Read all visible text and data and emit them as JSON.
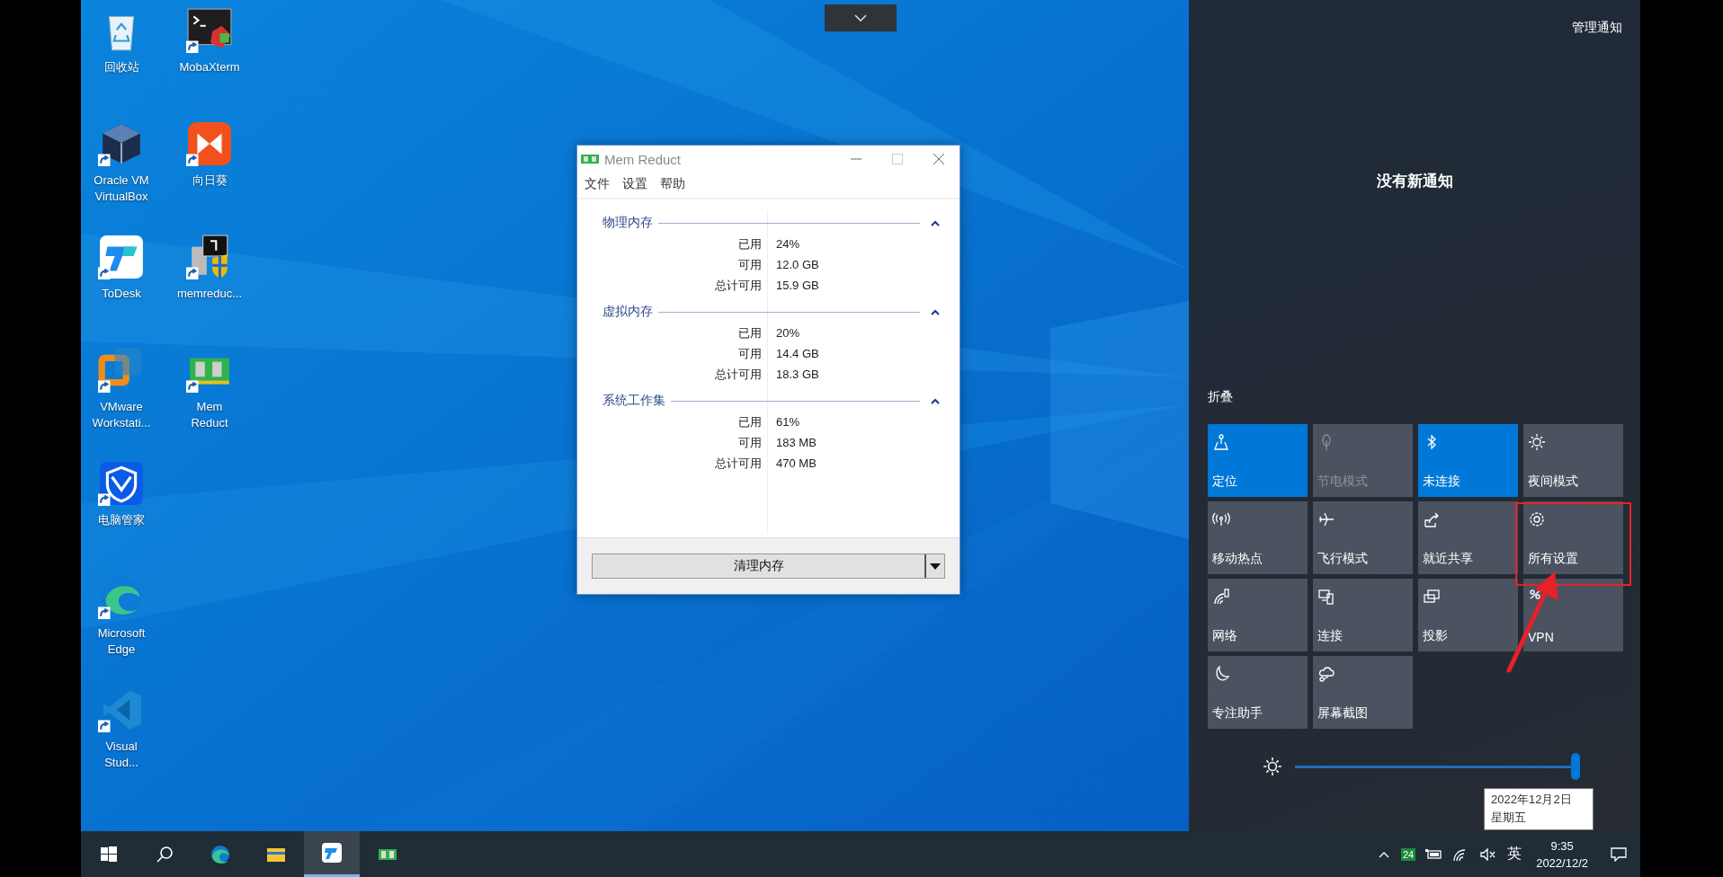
{
  "desktop": {
    "icons": [
      {
        "label": "回收站",
        "kind": "recycle",
        "shortcut": false
      },
      {
        "label": "Oracle VM VirtualBox",
        "kind": "cube",
        "shortcut": true
      },
      {
        "label": "ToDesk",
        "kind": "todesk",
        "shortcut": true
      },
      {
        "label": "VMware Workstati...",
        "kind": "vmware",
        "shortcut": true
      },
      {
        "label": "电脑管家",
        "kind": "shield",
        "shortcut": true
      },
      {
        "label": "Microsoft Edge",
        "kind": "edge",
        "shortcut": true
      },
      {
        "label": "Visual Stud...",
        "kind": "vscode",
        "shortcut": true
      },
      {
        "label": "MobaXterm",
        "kind": "terminal",
        "shortcut": true
      },
      {
        "label": "向日葵",
        "kind": "sunflower",
        "shortcut": true
      },
      {
        "label": "memreduc...",
        "kind": "installer",
        "shortcut": true
      },
      {
        "label": "Mem Reduct",
        "kind": "memory",
        "shortcut": true
      }
    ]
  },
  "window": {
    "title": "Mem Reduct",
    "menus": [
      "文件",
      "设置",
      "帮助"
    ],
    "sections": [
      {
        "title": "物理内存",
        "expanded": true,
        "rows": [
          {
            "label": "已用",
            "value": "24%"
          },
          {
            "label": "可用",
            "value": "12.0 GB"
          },
          {
            "label": "总计可用",
            "value": "15.9 GB"
          }
        ]
      },
      {
        "title": "虚拟内存",
        "expanded": true,
        "rows": [
          {
            "label": "已用",
            "value": "20%"
          },
          {
            "label": "可用",
            "value": "14.4 GB"
          },
          {
            "label": "总计可用",
            "value": "18.3 GB"
          }
        ]
      },
      {
        "title": "系统工作集",
        "expanded": true,
        "rows": [
          {
            "label": "已用",
            "value": "61%"
          },
          {
            "label": "可用",
            "value": "183 MB"
          },
          {
            "label": "总计可用",
            "value": "470 MB"
          }
        ]
      }
    ],
    "button": "清理内存"
  },
  "action_center": {
    "manage": "管理通知",
    "empty_message": "没有新通知",
    "collapse": "折叠",
    "tiles": [
      {
        "label": "定位",
        "kind": "location",
        "on": true,
        "disabled": false,
        "highlighted": false
      },
      {
        "label": "节电模式",
        "kind": "leaf",
        "on": false,
        "disabled": true,
        "highlighted": false
      },
      {
        "label": "未连接",
        "kind": "bluetooth",
        "on": true,
        "disabled": false,
        "highlighted": false
      },
      {
        "label": "夜间模式",
        "kind": "night",
        "on": false,
        "disabled": false,
        "highlighted": false
      },
      {
        "label": "移动热点",
        "kind": "hotspot",
        "on": false,
        "disabled": false,
        "highlighted": false
      },
      {
        "label": "飞行模式",
        "kind": "airplane",
        "on": false,
        "disabled": false,
        "highlighted": false
      },
      {
        "label": "就近共享",
        "kind": "share",
        "on": false,
        "disabled": false,
        "highlighted": false
      },
      {
        "label": "所有设置",
        "kind": "settings",
        "on": false,
        "disabled": false,
        "highlighted": true
      },
      {
        "label": "网络",
        "kind": "network",
        "on": false,
        "disabled": false,
        "highlighted": false
      },
      {
        "label": "连接",
        "kind": "connect",
        "on": false,
        "disabled": false,
        "highlighted": false
      },
      {
        "label": "投影",
        "kind": "project",
        "on": false,
        "disabled": false,
        "highlighted": false
      },
      {
        "label": "VPN",
        "kind": "vpn",
        "on": false,
        "disabled": false,
        "highlighted": false
      },
      {
        "label": "专注助手",
        "kind": "moon",
        "on": false,
        "disabled": false,
        "highlighted": false
      },
      {
        "label": "屏幕截图",
        "kind": "snip",
        "on": false,
        "disabled": false,
        "highlighted": false
      }
    ],
    "brightness": {
      "level": 1.0
    },
    "tooltip": [
      "2022年12月2日",
      "星期五"
    ]
  },
  "taskbar": {
    "apps": [
      {
        "kind": "start",
        "selected": false
      },
      {
        "kind": "search",
        "selected": false
      },
      {
        "kind": "edge",
        "selected": false
      },
      {
        "kind": "explorer",
        "selected": false
      },
      {
        "kind": "todesk",
        "selected": true
      },
      {
        "kind": "memory",
        "selected": false
      }
    ],
    "tray_badge": "24",
    "input_method": "英",
    "time": "9:35",
    "date": "2022/12/2"
  }
}
